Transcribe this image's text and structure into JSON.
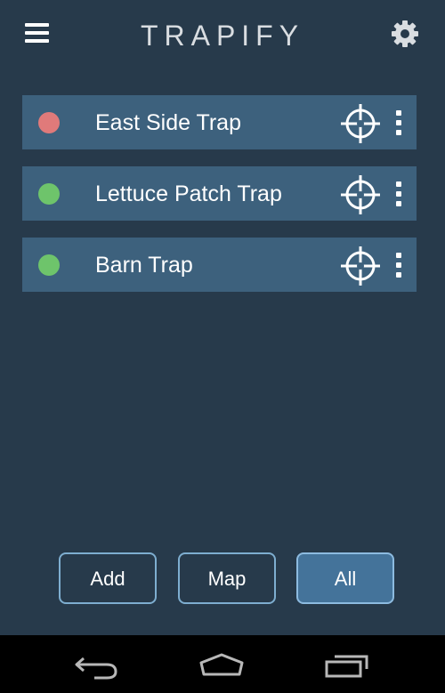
{
  "header": {
    "title": "TRAPIFY",
    "menu_icon": "hamburger-menu-icon",
    "settings_icon": "gear-icon"
  },
  "traps": [
    {
      "name": "East Side Trap",
      "status_color": "#e07a7a",
      "locate_icon": "crosshair-icon",
      "more_icon": "more-vertical-icon"
    },
    {
      "name": "Lettuce Patch Trap",
      "status_color": "#6ec46b",
      "locate_icon": "crosshair-icon",
      "more_icon": "more-vertical-icon"
    },
    {
      "name": "Barn Trap",
      "status_color": "#6ec46b",
      "locate_icon": "crosshair-icon",
      "more_icon": "more-vertical-icon"
    }
  ],
  "buttons": {
    "add_label": "Add",
    "map_label": "Map",
    "all_label": "All",
    "selected": "All"
  },
  "system_nav": {
    "back_icon": "back-icon",
    "home_icon": "home-icon",
    "recents_icon": "recent-apps-icon"
  },
  "colors": {
    "background": "#273a4b",
    "row_background": "#3d617d",
    "button_border": "#7eaed0",
    "button_active": "#44739a"
  }
}
